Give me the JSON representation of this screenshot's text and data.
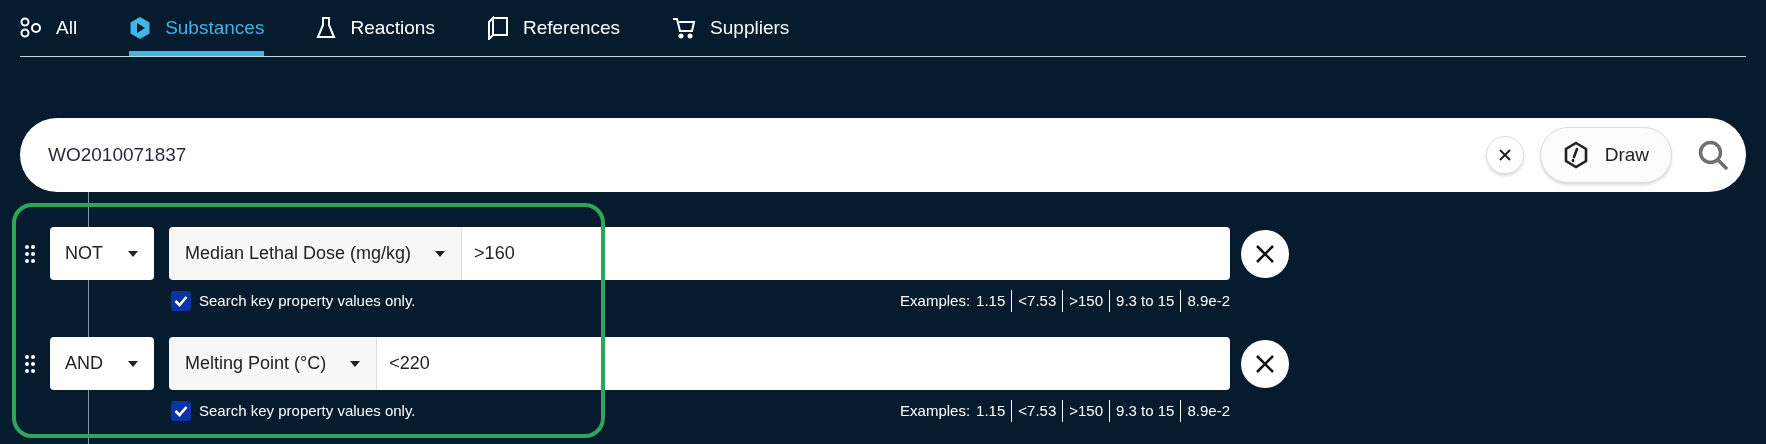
{
  "tabs": [
    {
      "label": "All",
      "selected": false
    },
    {
      "label": "Substances",
      "selected": true
    },
    {
      "label": "Reactions",
      "selected": false
    },
    {
      "label": "References",
      "selected": false
    },
    {
      "label": "Suppliers",
      "selected": false
    }
  ],
  "search": {
    "value": "WO2010071837",
    "draw_button": "Draw"
  },
  "filters": [
    {
      "operator": "NOT",
      "property": "Median Lethal Dose (mg/kg)",
      "value": ">160",
      "key_only": {
        "label": "Search key property values only.",
        "checked": true
      },
      "examples_label": "Examples:",
      "examples": [
        "1.15",
        "<7.53",
        ">150",
        "9.3 to 15",
        "8.9e-2"
      ]
    },
    {
      "operator": "AND",
      "property": "Melting Point (°C)",
      "value": "<220",
      "key_only": {
        "label": "Search key property values only.",
        "checked": true
      },
      "examples_label": "Examples:",
      "examples": [
        "1.15",
        "<7.53",
        ">150",
        "9.3 to 15",
        "8.9e-2"
      ]
    }
  ]
}
